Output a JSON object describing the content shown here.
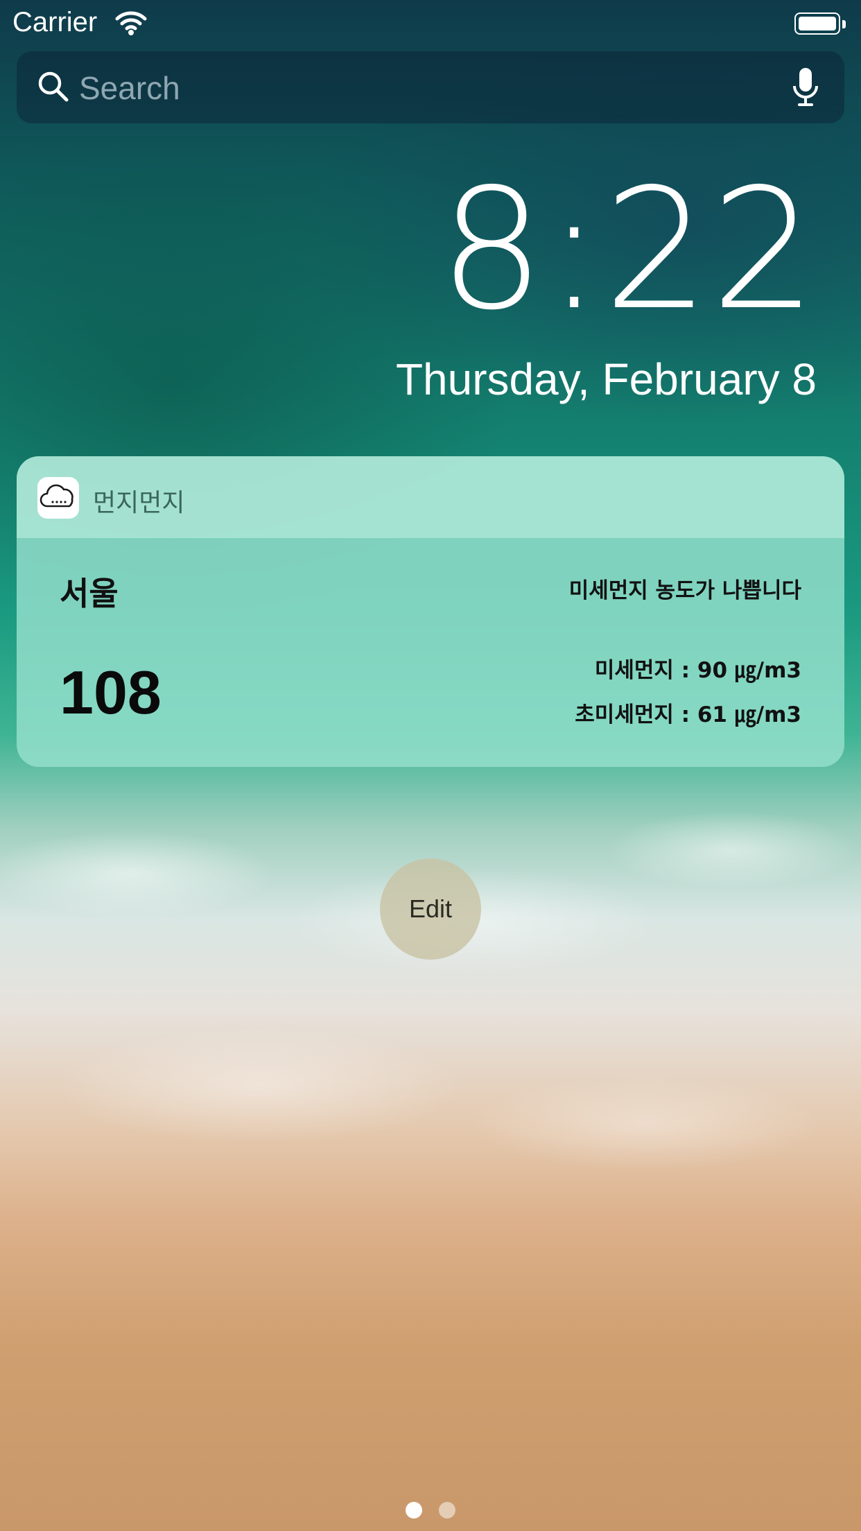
{
  "status_bar": {
    "carrier": "Carrier"
  },
  "search": {
    "placeholder": "Search"
  },
  "lock": {
    "time": "8:22",
    "date": "Thursday, February 8"
  },
  "widget": {
    "app_name": "먼지먼지",
    "city": "서울",
    "aqi": "108",
    "status_message": "미세먼지 농도가 나쁩니다",
    "pm10": "미세먼지 : 90 ㎍/m3",
    "pm25": "초미세먼지 : 61 ㎍/m3"
  },
  "edit": {
    "label": "Edit"
  },
  "pagination": {
    "current_page": 1,
    "total_pages": 2
  },
  "icons": [
    "wifi-icon",
    "battery-icon",
    "search-icon",
    "mic-icon",
    "cloud-icon"
  ]
}
